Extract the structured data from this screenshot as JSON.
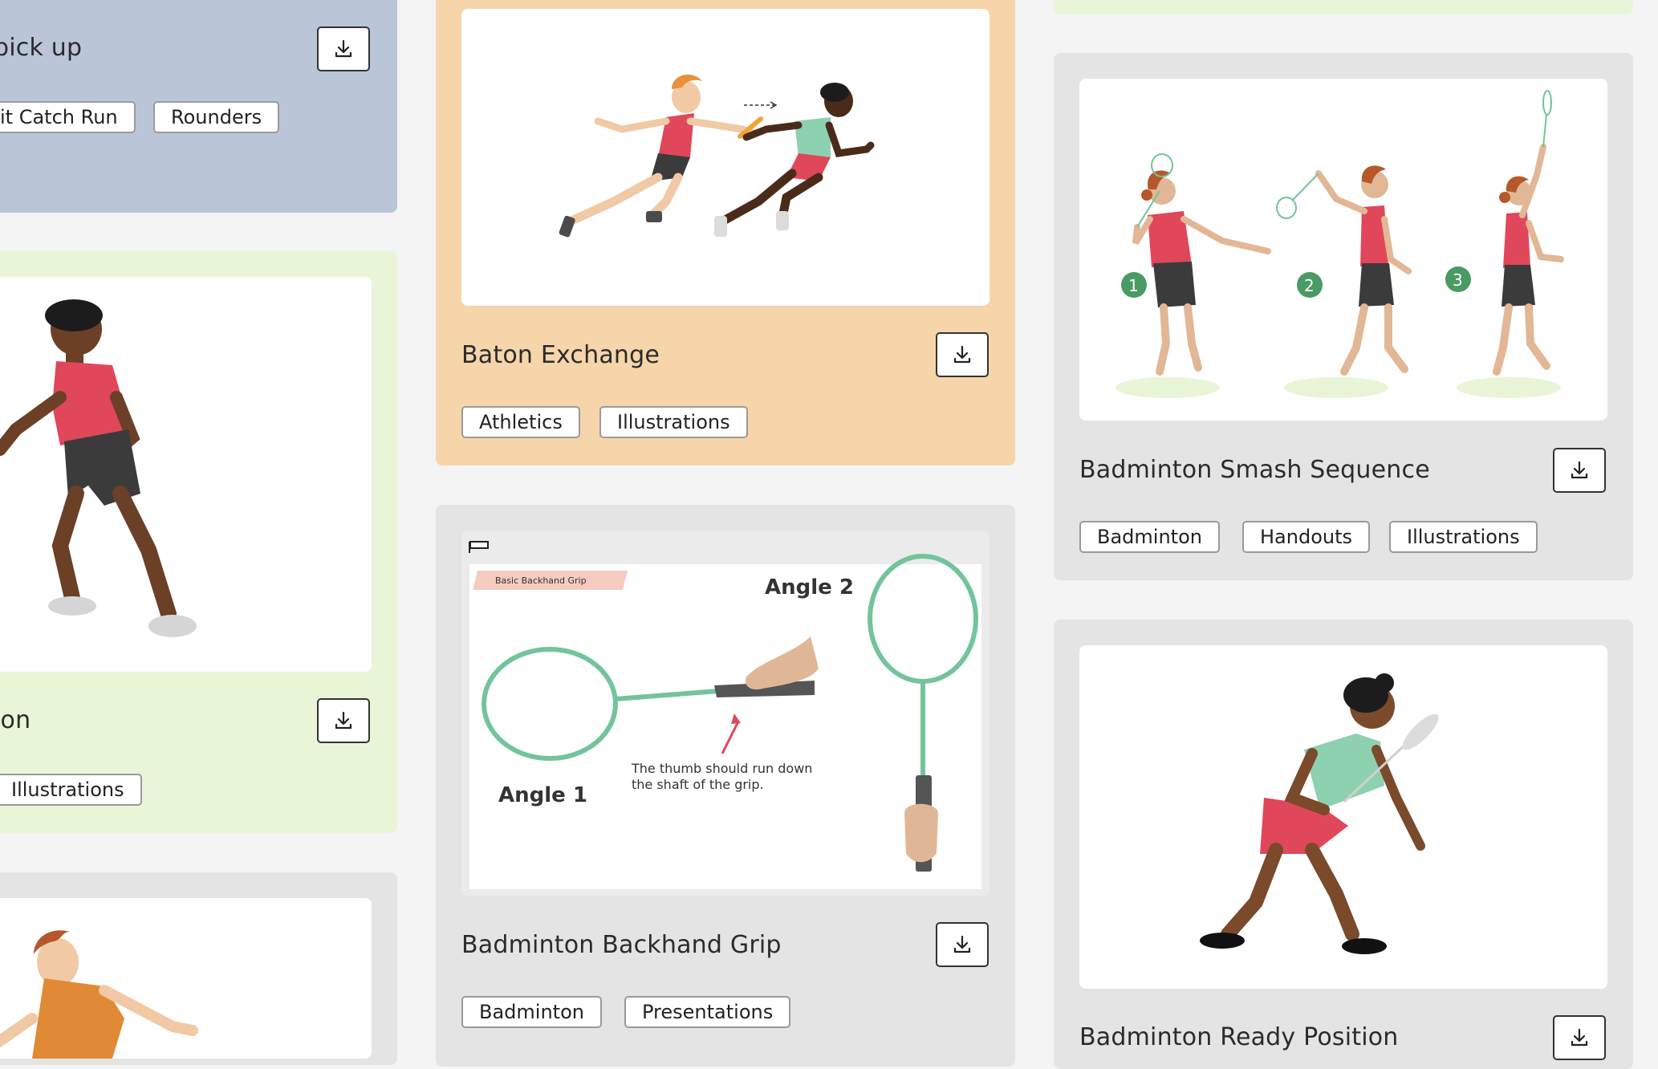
{
  "cards": [
    {
      "id": "pickup",
      "title": "pick up",
      "tags": [
        "it Catch Run",
        "Rounders"
      ],
      "color": "#bac6d8"
    },
    {
      "id": "position",
      "title": "ion",
      "tags": [
        "Illustrations"
      ],
      "color": "#e9f5d7"
    },
    {
      "id": "baton",
      "title": "Baton Exchange",
      "tags": [
        "Athletics",
        "Illustrations"
      ],
      "color": "#f6d5aa"
    },
    {
      "id": "backhand",
      "title": "Badminton Backhand Grip",
      "tags": [
        "Badminton",
        "Presentations"
      ],
      "color": "#e4e4e4",
      "slide": {
        "banner": "Basic Backhand Grip",
        "angle1": "Angle 1",
        "angle2": "Angle 2",
        "note_line1": "The thumb should run down",
        "note_line2": "the shaft of the grip."
      }
    },
    {
      "id": "smash",
      "title": "Badminton Smash Sequence",
      "tags": [
        "Badminton",
        "Handouts",
        "Illustrations"
      ],
      "color": "#e4e4e4",
      "steps": [
        "1",
        "2",
        "3"
      ]
    },
    {
      "id": "ready",
      "title": "Badminton Ready Position",
      "tags": [],
      "color": "#e4e4e4"
    }
  ],
  "icons": {
    "download": "download-icon"
  }
}
